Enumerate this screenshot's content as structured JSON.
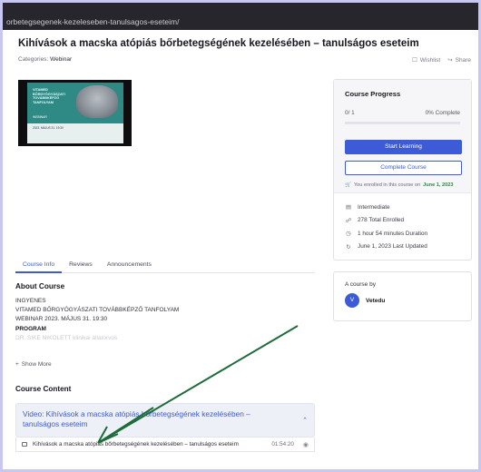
{
  "browser": {
    "url": "orbetegsegenek-kezeleseben-tanulsagos-eseteim/"
  },
  "course": {
    "title": "Kihívások a macska atópiás bőrbetegségének kezelésében – tanulságos eseteim",
    "categories_label": "Categories:",
    "category": "Webinar",
    "wishlist": "Wishlist",
    "share": "Share"
  },
  "thumbnail": {
    "line1": "VITAMED",
    "line2": "BŐRGYÓGYÁSZATI",
    "line3": "TOVÁBBKÉPZŐ",
    "line4": "TANFOLYAM",
    "webinar": "WEBINAR",
    "date": "2023. MÁJUS 31. 19:30"
  },
  "tabs": [
    "Course Info",
    "Reviews",
    "Announcements"
  ],
  "about": {
    "heading": "About Course",
    "lines": [
      "INGYENES",
      "VITAMED BŐRGYÓGYÁSZATI TOVÁBBKÉPZŐ TANFOLYAM",
      "WEBINAR 2023. MÁJUS 31. 19:30"
    ],
    "program": "PROGRAM",
    "faded": "DR. SIKE NIKOLETT klinikai állatorvos",
    "show_more": "Show More"
  },
  "content": {
    "heading": "Course Content",
    "topic_title": "Video: Kihívások a macska atópiás bőrbetegségének kezelésében – tanulságos eseteim",
    "lesson_title": "Kihívások a macska atópiás bőrbetegségének kezelésében – tanulságos eseteim",
    "lesson_duration": "01:54:20"
  },
  "progress": {
    "heading": "Course Progress",
    "count": "0/ 1",
    "percent": "0% Complete",
    "fraction": 0,
    "start_button": "Start Learning",
    "complete_button": "Complete Course",
    "enrolled_text": "You enrolled in this course on",
    "enrolled_date": "June 1, 2023"
  },
  "meta": {
    "level": "Intermediate",
    "enrolled": "278 Total Enrolled",
    "duration": "1 hour  54 minutes  Duration",
    "updated": "June 1, 2023 Last Updated"
  },
  "author": {
    "label": "A course by",
    "initial": "V",
    "name": "Vetedu"
  },
  "colors": {
    "accent": "#3d5bd6",
    "annotation_arrow": "#1e6b3a",
    "success": "#2b8a3e"
  }
}
